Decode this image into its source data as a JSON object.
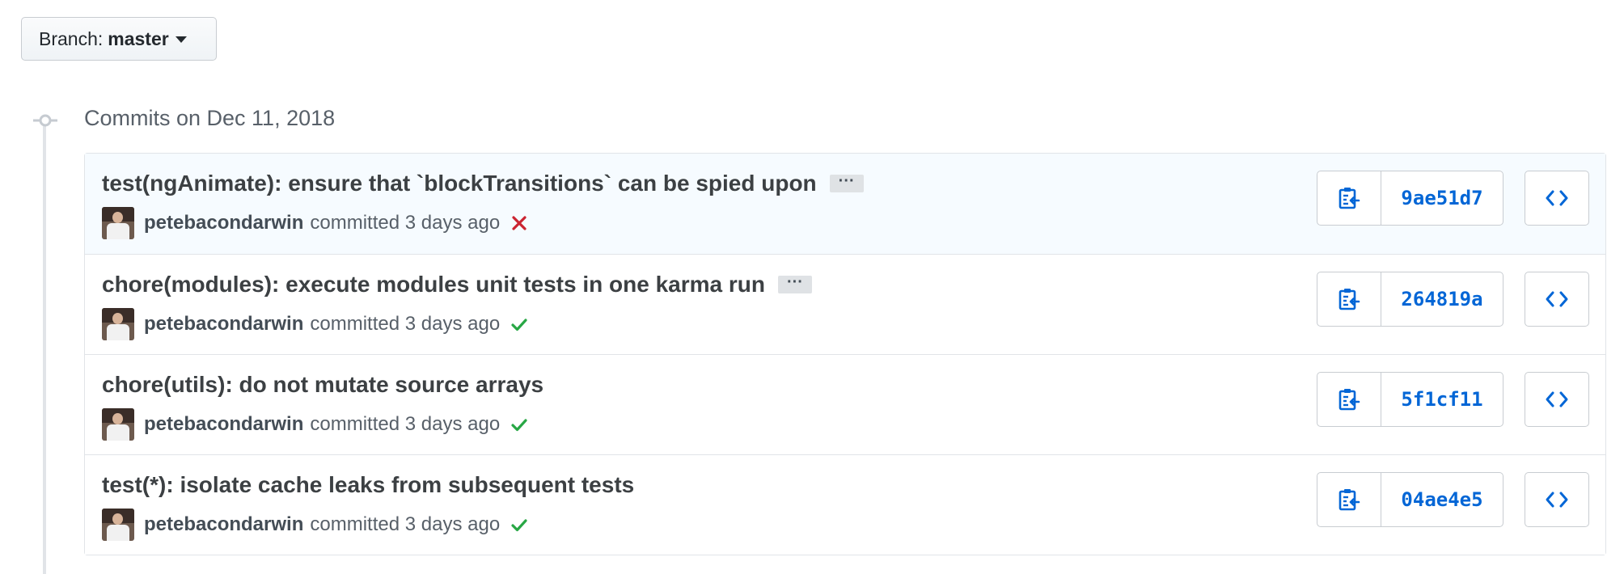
{
  "branch": {
    "label": "Branch:",
    "value": "master"
  },
  "commit_group": {
    "date_heading": "Commits on Dec 11, 2018",
    "commits": [
      {
        "title": "test(ngAnimate): ensure that `blockTransitions` can be spied upon",
        "has_ellipsis": true,
        "ellipsis": "···",
        "author": "petebacondarwin",
        "action": "committed",
        "time": "3 days ago",
        "status": "failure",
        "sha": "9ae51d7"
      },
      {
        "title": "chore(modules): execute modules unit tests in one karma run",
        "has_ellipsis": true,
        "ellipsis": "···",
        "author": "petebacondarwin",
        "action": "committed",
        "time": "3 days ago",
        "status": "success",
        "sha": "264819a"
      },
      {
        "title": "chore(utils): do not mutate source arrays",
        "has_ellipsis": false,
        "ellipsis": "",
        "author": "petebacondarwin",
        "action": "committed",
        "time": "3 days ago",
        "status": "success",
        "sha": "5f1cf11"
      },
      {
        "title": "test(*): isolate cache leaks from subsequent tests",
        "has_ellipsis": false,
        "ellipsis": "",
        "author": "petebacondarwin",
        "action": "committed",
        "time": "3 days ago",
        "status": "success",
        "sha": "04ae4e5"
      }
    ]
  },
  "icons": {
    "copy": "clipboard-icon",
    "browse": "code-brackets-icon",
    "success": "check-icon",
    "failure": "x-icon",
    "timeline": "git-commit-icon"
  },
  "colors": {
    "link": "#0366d6",
    "success": "#28a745",
    "failure": "#cb2431",
    "highlight_row": "#f6fbff"
  }
}
